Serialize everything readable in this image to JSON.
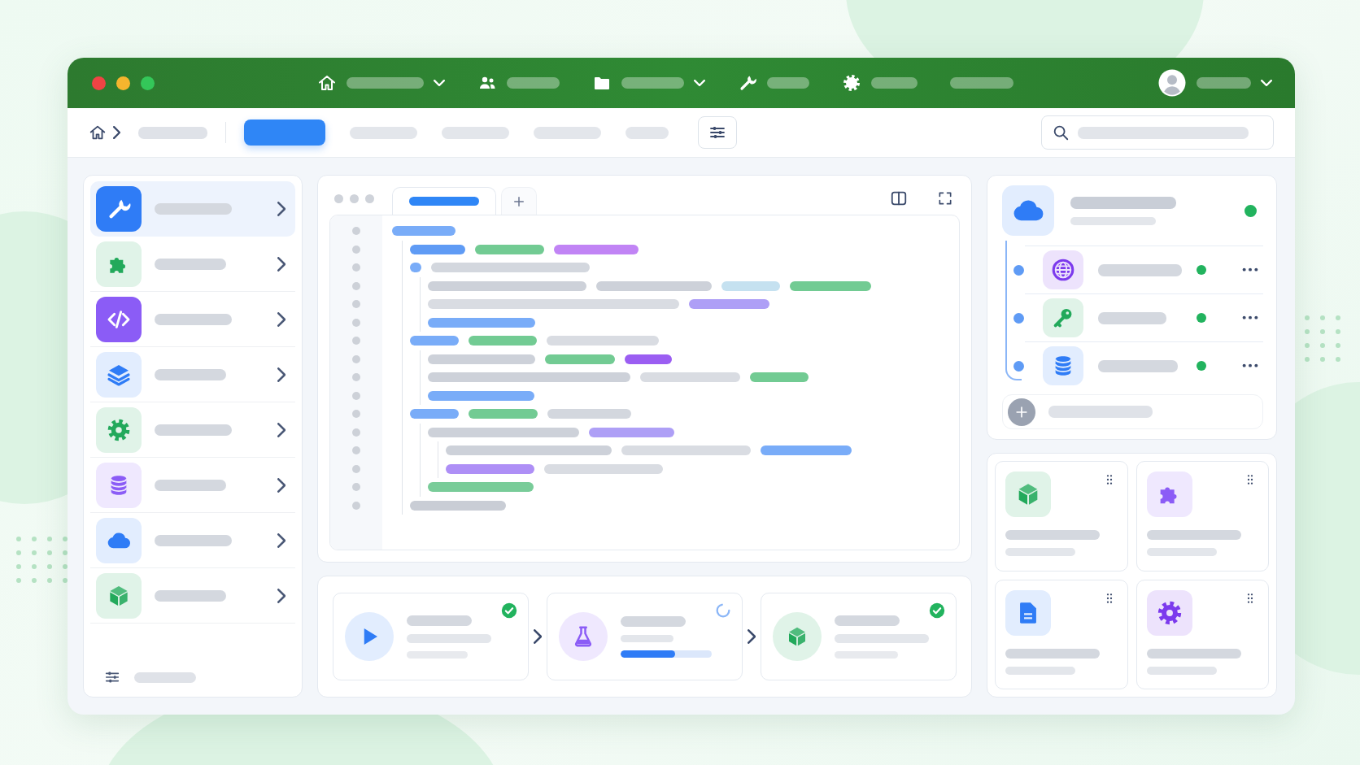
{
  "window": {
    "controls": [
      {
        "color": "#ef4444"
      },
      {
        "color": "#f5b52e"
      },
      {
        "color": "#34c759"
      }
    ]
  },
  "top_nav": [
    {
      "kind": "home",
      "dropdown": true
    },
    {
      "kind": "people",
      "dropdown": false
    },
    {
      "kind": "folder",
      "dropdown": true
    },
    {
      "kind": "wrench",
      "dropdown": false
    },
    {
      "kind": "gear",
      "dropdown": false
    },
    {
      "kind": "plain",
      "dropdown": false
    }
  ],
  "account": {
    "dropdown": true
  },
  "toolbar": {
    "tabs": [
      {
        "selected": true
      },
      {
        "selected": false
      },
      {
        "selected": false
      },
      {
        "selected": false
      },
      {
        "selected": false
      }
    ]
  },
  "sidebar": {
    "items": [
      {
        "kind": "wrench",
        "color": "#2f7cf6",
        "solid": true,
        "selected": true
      },
      {
        "kind": "puzzle",
        "color": "#22a95b",
        "solid": false,
        "selected": false
      },
      {
        "kind": "code",
        "color": "#8b5cf6",
        "solid": true,
        "selected": false
      },
      {
        "kind": "layers",
        "color": "#2f7cf6",
        "solid": false,
        "selected": false
      },
      {
        "kind": "gear",
        "color": "#22a95b",
        "solid": false,
        "selected": false
      },
      {
        "kind": "database",
        "color": "#8b5cf6",
        "solid": false,
        "selected": false
      },
      {
        "kind": "cloud",
        "color": "#2f7cf6",
        "solid": false,
        "selected": false
      },
      {
        "kind": "cube",
        "color": "#22a95b",
        "solid": false,
        "selected": false
      }
    ]
  },
  "editor": {
    "tabs": [
      {
        "selected": true
      }
    ],
    "lines": [
      {
        "tokens": [
          {
            "color": "#79acf8"
          }
        ],
        "children": [
          {
            "tokens": [
              {
                "color": "#5f9bf5"
              },
              {
                "color": "#72cb93"
              },
              {
                "color": "#c184f5"
              }
            ]
          },
          {
            "tokens": [
              {
                "color": "#79acf8"
              },
              {
                "color": "#d3d7de"
              }
            ],
            "children": [
              {
                "tokens": [
                  {
                    "color": "#cdd1d9"
                  },
                  {
                    "color": "#cdd1d9"
                  },
                  {
                    "color": "#c5e1f0"
                  },
                  {
                    "color": "#72cb93"
                  }
                ]
              },
              {
                "tokens": [
                  {
                    "color": "#d9dce2"
                  },
                  {
                    "color": "#ae9ff6"
                  }
                ]
              },
              {
                "tokens": [
                  {
                    "color": "#79acf8"
                  }
                ]
              }
            ]
          },
          {
            "tokens": [
              {
                "color": "#79acf8"
              },
              {
                "color": "#72cb93"
              },
              {
                "color": "#d9dce2"
              }
            ],
            "children": [
              {
                "tokens": [
                  {
                    "color": "#cdd1d9"
                  },
                  {
                    "color": "#72cb93"
                  },
                  {
                    "color": "#9b5ef2"
                  }
                ]
              },
              {
                "tokens": [
                  {
                    "color": "#cdd1d9"
                  },
                  {
                    "color": "#d9dce2"
                  },
                  {
                    "color": "#72cb93"
                  }
                ]
              },
              {
                "tokens": [
                  {
                    "color": "#79acf8"
                  }
                ]
              }
            ]
          },
          {
            "tokens": [
              {
                "color": "#79acf8"
              },
              {
                "color": "#72cb93"
              },
              {
                "color": "#d3d7de"
              }
            ],
            "children": [
              {
                "tokens": [
                  {
                    "color": "#cdd1d9"
                  },
                  {
                    "color": "#ae9ff6"
                  }
                ],
                "children": [
                  {
                    "tokens": [
                      {
                        "color": "#cdd1d9"
                      },
                      {
                        "color": "#d9dce2"
                      },
                      {
                        "color": "#79acf8"
                      }
                    ]
                  },
                  {
                    "tokens": [
                      {
                        "color": "#ae8ff6"
                      },
                      {
                        "color": "#d9dce2"
                      }
                    ]
                  }
                ]
              },
              {
                "tokens": [
                  {
                    "color": "#79cc99"
                  }
                ]
              }
            ]
          },
          {
            "tokens": [
              {
                "color": "#c9cdd5"
              }
            ]
          }
        ]
      }
    ]
  },
  "pipeline": {
    "steps": [
      {
        "kind": "play",
        "color": "#2f7cf6",
        "done": true
      },
      {
        "kind": "flask",
        "color": "#8b5cf6",
        "done": false,
        "level": 0.6
      },
      {
        "kind": "cube",
        "color": "#22a95b",
        "done": true
      }
    ]
  },
  "service": {
    "kind": "cloud",
    "color": "#2f7cf6",
    "children": [
      {
        "kind": "globe",
        "color": "#7c3aed"
      },
      {
        "kind": "key",
        "color": "#22a95b"
      },
      {
        "kind": "database",
        "color": "#2f7cf6"
      }
    ]
  },
  "cards": [
    {
      "kind": "cube",
      "color": "#22a95b"
    },
    {
      "kind": "puzzle",
      "color": "#8b5cf6"
    },
    {
      "kind": "document",
      "color": "#2f7cf6"
    },
    {
      "kind": "gear",
      "color": "#7c3aed"
    }
  ]
}
